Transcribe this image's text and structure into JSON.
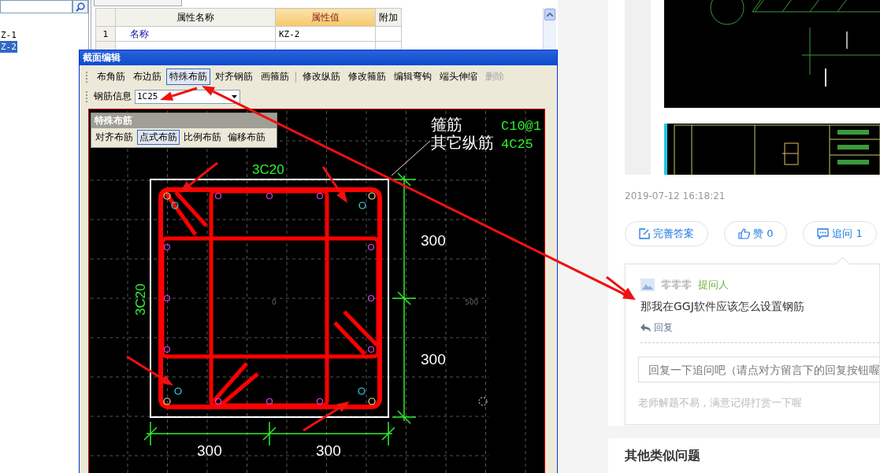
{
  "tree_items": [
    {
      "label": "Z-1",
      "selected": false
    },
    {
      "label": "Z-2",
      "selected": true
    }
  ],
  "property_table": {
    "columns": [
      {
        "label": "属性名称",
        "selected": false
      },
      {
        "label": "属性值",
        "selected": true
      },
      {
        "label": "附加",
        "selected": false
      }
    ],
    "rows": [
      {
        "index": "1",
        "name": "名称",
        "value": "KZ-2"
      }
    ]
  },
  "dialog": {
    "title": "截面编辑",
    "toolbar": [
      [
        {
          "label": "布角筋",
          "selected": false,
          "disabled": false
        },
        {
          "label": "布边筋",
          "selected": false,
          "disabled": false
        },
        {
          "label": "特殊布筋",
          "selected": true,
          "disabled": false
        },
        {
          "label": "对齐钢筋",
          "selected": false,
          "disabled": false
        },
        {
          "label": "画箍筋",
          "selected": false,
          "disabled": false
        }
      ],
      [
        {
          "label": "修改纵筋",
          "selected": false,
          "disabled": false
        },
        {
          "label": "修改箍筋",
          "selected": false,
          "disabled": false
        },
        {
          "label": "编辑弯钩",
          "selected": false,
          "disabled": false
        },
        {
          "label": "端头伸缩",
          "selected": false,
          "disabled": false
        },
        {
          "label": "删除",
          "selected": false,
          "disabled": true
        }
      ]
    ],
    "rebar_info": {
      "label": "钢筋信息",
      "value": "1C25"
    },
    "special_panel": {
      "title": "特殊布筋",
      "buttons": [
        {
          "label": "对齐布筋",
          "selected": false
        },
        {
          "label": "点式布筋",
          "selected": true
        },
        {
          "label": "比例布筋",
          "selected": false
        },
        {
          "label": "偏移布筋",
          "selected": false
        }
      ]
    },
    "canvas": {
      "legend": [
        {
          "name": "箍筋",
          "value": "C10@1"
        },
        {
          "name": "其它纵筋",
          "value": "4C25"
        }
      ],
      "top_label": "3C20",
      "left_label": "3C20",
      "dims": [
        "300",
        "300",
        "300",
        "300"
      ],
      "axis_labels": [
        "0",
        "500"
      ]
    }
  },
  "answer": {
    "timestamp": "2019-07-12 16:18:21",
    "actions": [
      {
        "label": "完善答案",
        "kind": "edit"
      },
      {
        "label": "赞 0",
        "kind": "like"
      },
      {
        "label": "追问 1",
        "kind": "comment"
      }
    ],
    "follow_up": {
      "user": "零零零",
      "role": "提问人",
      "text": "那我在GGJ软件应该怎么设置钢筋",
      "reply": "回复",
      "input_placeholder": "回复一下追问吧（请点对方留言下的回复按钮喔",
      "hint": "老师解题不易，满意记得打赏一下喔"
    }
  },
  "similar": {
    "title": "其他类似问题"
  }
}
